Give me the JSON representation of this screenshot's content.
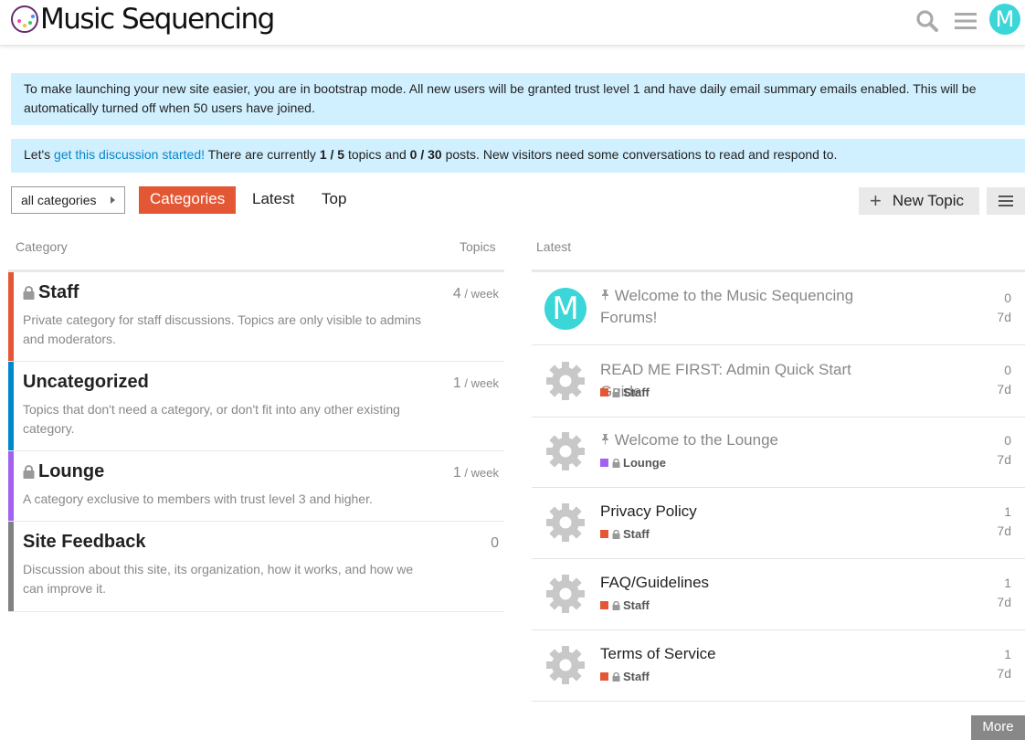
{
  "header": {
    "site_title": "Music Sequencing",
    "avatar_letter": "M",
    "icons": [
      "search-icon",
      "hamburger-menu-icon"
    ]
  },
  "notices": {
    "bootstrap": "To make launching your new site easier, you are in bootstrap mode. All new users will be granted trust level 1 and have daily email summary emails enabled. This will be automatically turned off when 50 users have joined.",
    "discussion_prefix": "Let's ",
    "discussion_link": "get this discussion started!",
    "discussion_mid1": " There are currently ",
    "topics_count": "1 / 5",
    "discussion_mid2": " topics and ",
    "posts_count": "0 / 30",
    "discussion_suffix": " posts. New visitors need some conversations to read and respond to."
  },
  "nav": {
    "category_dropdown": "all categories",
    "tabs": [
      "Categories",
      "Latest",
      "Top"
    ],
    "new_topic": "New Topic"
  },
  "categories_table": {
    "col_category": "Category",
    "col_topics": "Topics",
    "rows": [
      {
        "name": "Staff",
        "locked": true,
        "color": "#e45735",
        "description": "Private category for staff discussions. Topics are only visible to admins and moderators.",
        "count": "4",
        "unit": " / week"
      },
      {
        "name": "Uncategorized",
        "locked": false,
        "color": "#0088cc",
        "description": "Topics that don't need a category, or don't fit into any other existing category.",
        "count": "1",
        "unit": " / week"
      },
      {
        "name": "Lounge",
        "locked": true,
        "color": "#a461ef",
        "description": "A category exclusive to members with trust level 3 and higher.",
        "count": "1",
        "unit": " / week"
      },
      {
        "name": "Site Feedback",
        "locked": false,
        "color": "#808281",
        "description": "Discussion about this site, its organization, how it works, and how we can improve it.",
        "count": "0",
        "unit": ""
      }
    ]
  },
  "latest": {
    "col_latest": "Latest",
    "topics": [
      {
        "title": "Welcome to the Music Sequencing Forums!",
        "pinned": true,
        "avatar": "M",
        "category": "",
        "category_color": "",
        "posts": "0",
        "age": "7d"
      },
      {
        "title": "READ ME FIRST: Admin Quick Start Guide",
        "pinned": false,
        "avatar": "gear",
        "category": "Staff",
        "category_color": "#e45735",
        "posts": "0",
        "age": "7d"
      },
      {
        "title": "Welcome to the Lounge",
        "pinned": true,
        "avatar": "gear",
        "category": "Lounge",
        "category_color": "#a461ef",
        "posts": "0",
        "age": "7d"
      },
      {
        "title": "Privacy Policy",
        "pinned": false,
        "avatar": "gear",
        "category": "Staff",
        "category_color": "#e45735",
        "posts": "1",
        "age": "7d"
      },
      {
        "title": "FAQ/Guidelines",
        "pinned": false,
        "avatar": "gear",
        "category": "Staff",
        "category_color": "#e45735",
        "posts": "1",
        "age": "7d"
      },
      {
        "title": "Terms of Service",
        "pinned": false,
        "avatar": "gear",
        "category": "Staff",
        "category_color": "#e45735",
        "posts": "1",
        "age": "7d"
      }
    ],
    "more_label": "More"
  }
}
